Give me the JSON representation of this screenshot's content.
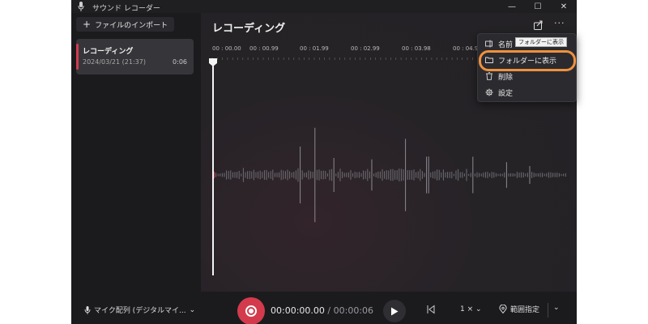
{
  "app": {
    "title": "サウンド レコーダー"
  },
  "window_controls": {
    "minimize": "—",
    "maximize": "☐",
    "close": "✕"
  },
  "sidebar": {
    "import_label": "ファイルのインポート",
    "recordings": [
      {
        "name": "レコーディング",
        "date": "2024/03/21 (21:37)",
        "duration": "0:06"
      }
    ]
  },
  "main": {
    "title": "レコーディング",
    "more_label": "···",
    "timeline_labels": [
      "00 : 00.00",
      "00 : 00.99",
      "00 : 01.99",
      "00 : 02.99",
      "00 : 03.98",
      "00 : 04.98"
    ]
  },
  "menu": {
    "items": [
      {
        "label": "名前",
        "icon": "rename-icon"
      },
      {
        "label": "フォルダーに表示",
        "icon": "folder-icon"
      },
      {
        "label": "削除",
        "icon": "trash-icon"
      },
      {
        "label": "設定",
        "icon": "gear-icon"
      }
    ],
    "tooltip": "フォルダーに表示"
  },
  "bottom": {
    "mic_label": "マイク配列 (デジタルマイ...",
    "current_time": "00:00:00.00",
    "separator": "/",
    "total_time": "00:00:06",
    "speed": "1 ×",
    "range_label": "範囲指定"
  },
  "colors": {
    "accent_red": "#d33b4d",
    "highlight_orange": "#f0913e",
    "window_bg": "#1f1f22"
  }
}
